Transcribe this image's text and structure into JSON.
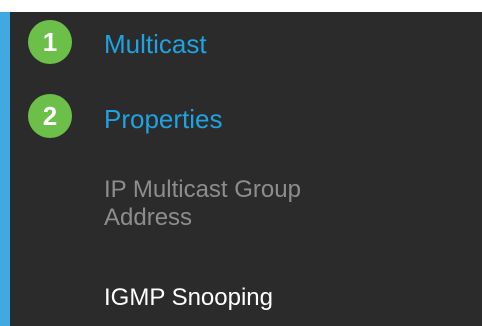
{
  "menu": {
    "items": [
      {
        "label": "Multicast",
        "step": "1"
      },
      {
        "label": "Properties",
        "step": "2"
      },
      {
        "label_line1": "IP Multicast Group",
        "label_line2": "Address"
      },
      {
        "label": "IGMP Snooping"
      }
    ]
  },
  "colors": {
    "panel_background": "#2b2b2b",
    "accent_bar": "#41a9e1",
    "link_blue": "#1fa3e0",
    "inactive_text": "#8d8d8d",
    "active_text": "#ffffff",
    "badge_green": "#6cc04a"
  }
}
